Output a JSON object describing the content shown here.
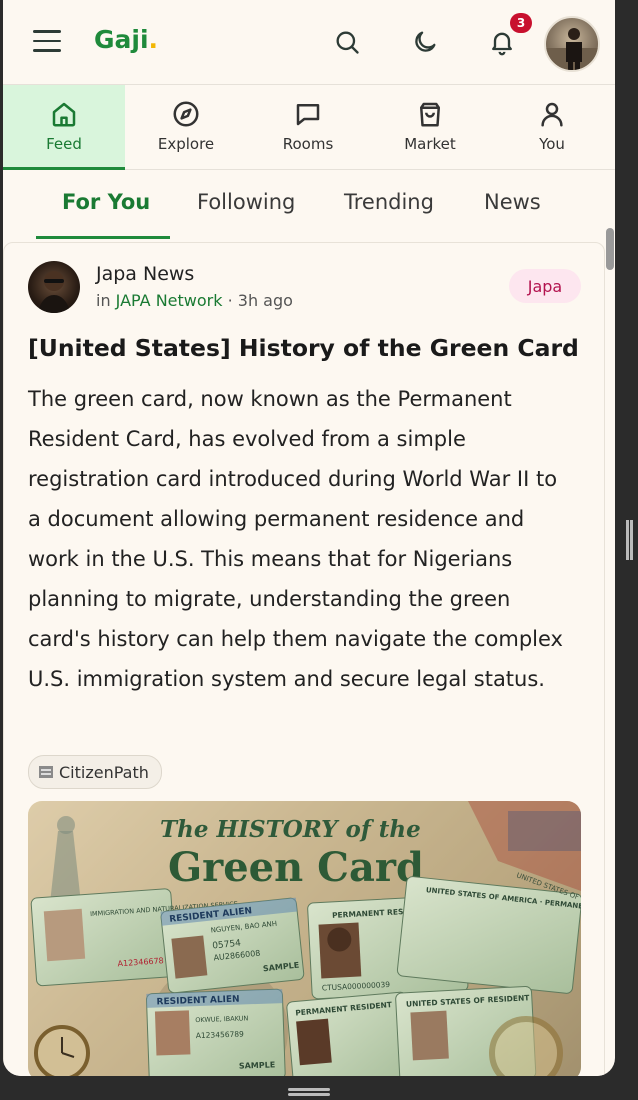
{
  "app": {
    "logo": "Gaji",
    "logo_dot": "."
  },
  "header": {
    "notifications_count": "3"
  },
  "nav": {
    "items": [
      {
        "label": "Feed",
        "icon": "home-icon",
        "active": true
      },
      {
        "label": "Explore",
        "icon": "compass-icon"
      },
      {
        "label": "Rooms",
        "icon": "chat-bubble-icon"
      },
      {
        "label": "Market",
        "icon": "shopping-bag-icon"
      },
      {
        "label": "You",
        "icon": "user-icon"
      }
    ]
  },
  "tabs": [
    "For You",
    "Following",
    "Trending",
    "News"
  ],
  "post": {
    "author": "Japa News",
    "meta_prefix": "in ",
    "network": "JAPA Network",
    "time": " · 3h ago",
    "tag": "Japa",
    "title": "[United States] History of the Green Card",
    "body": "The green card, now known as the Permanent Resident Card, has evolved from a simple registration card introduced during World War II to a document allowing permanent residence and work in the U.S. This means that for Nigerians planning to migrate, understanding the green card's history can help them navigate the complex U.S. immigration system and secure legal status.",
    "source": "CitizenPath",
    "image": {
      "headline_small": "The HISTORY of the",
      "headline_large": "Green Card",
      "card1_text": "IMMIGRATION AND NATURALIZATION SERVICE",
      "card1_number": "A12346678",
      "card2_title": "RESIDENT ALIEN",
      "card2_name": "NGUYEN, BAO ANH",
      "card2_number": "05754",
      "card2_code": "AU2866008",
      "card2_sample": "SAMPLE",
      "card3_title": "PERMANENT RESIDENT CARD",
      "card3_number": "CTUSA000000039",
      "card4_title": "UNITED STATES OF AMERICA · PERMANENT RESIDENT",
      "card5_title": "RESIDENT ALIEN",
      "card5_name": "OKWUE, IBAKUN",
      "card5_number": "A123456789",
      "card5_sample": "SAMPLE",
      "card6_title": "PERMANENT RESIDENT",
      "card7_title": "UNITED STATES OF RESIDENT",
      "corner_text": "UNITED STATES OF"
    }
  }
}
